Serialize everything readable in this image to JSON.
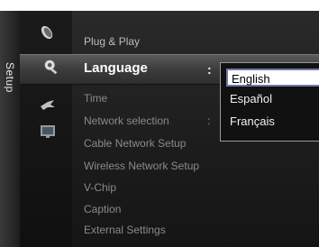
{
  "sidebar": {
    "label": "Setup"
  },
  "menu": {
    "items": [
      {
        "label": "Plug & Play"
      },
      {
        "label": "Language"
      },
      {
        "label": "Time"
      },
      {
        "label": "Network selection"
      },
      {
        "label": "Cable Network Setup"
      },
      {
        "label": "Wireless Network Setup"
      },
      {
        "label": "V-Chip"
      },
      {
        "label": "Caption"
      },
      {
        "label": "External Settings"
      }
    ],
    "separator": ":"
  },
  "dropdown": {
    "options": [
      "English",
      "Español",
      "Français"
    ],
    "selected": "English"
  },
  "icons": [
    "satellite-dish-icon",
    "gear-wrench-icon",
    "bird-icon",
    "tv-screen-icon"
  ]
}
